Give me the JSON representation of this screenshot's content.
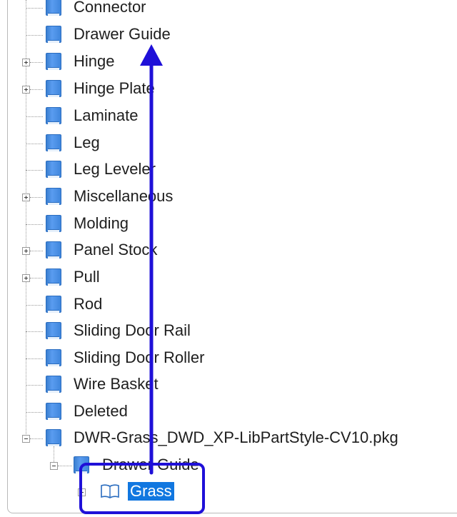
{
  "tree": {
    "items": [
      {
        "label": "Connector",
        "expandable": false
      },
      {
        "label": "Drawer Guide",
        "expandable": false
      },
      {
        "label": "Hinge",
        "expandable": true
      },
      {
        "label": "Hinge Plate",
        "expandable": true
      },
      {
        "label": "Laminate",
        "expandable": false
      },
      {
        "label": "Leg",
        "expandable": false
      },
      {
        "label": "Leg Leveler",
        "expandable": false
      },
      {
        "label": "Miscellaneous",
        "expandable": true
      },
      {
        "label": "Molding",
        "expandable": false
      },
      {
        "label": "Panel Stock",
        "expandable": true
      },
      {
        "label": "Pull",
        "expandable": true
      },
      {
        "label": "Rod",
        "expandable": false
      },
      {
        "label": "Sliding Door Rail",
        "expandable": false
      },
      {
        "label": "Sliding Door Roller",
        "expandable": false
      },
      {
        "label": "Wire Basket",
        "expandable": false
      },
      {
        "label": "Deleted",
        "expandable": false
      },
      {
        "label": "DWR-Grass_DWD_XP-LibPartStyle-CV10.pkg",
        "expandable": true,
        "expanded": true
      }
    ],
    "child": {
      "label": "Drawer Guide",
      "expanded": true
    },
    "grandchild": {
      "label": "Grass",
      "selected": true
    }
  },
  "colors": {
    "selection": "#1177e0",
    "annotation": "#1f10d8",
    "book_icon": "#4a90e2"
  }
}
